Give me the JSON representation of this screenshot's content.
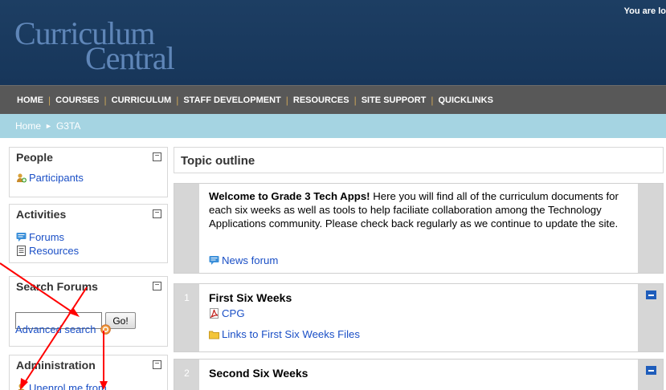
{
  "header": {
    "logo_line1": "Curriculum",
    "logo_line2": "Central",
    "login_info": "You are lo"
  },
  "nav": {
    "items": [
      "HOME",
      "COURSES",
      "CURRICULUM",
      "STAFF DEVELOPMENT",
      "RESOURCES",
      "SITE SUPPORT",
      "QUICKLINKS"
    ],
    "separator": "|"
  },
  "breadcrumb": {
    "home": "Home",
    "separator": "►",
    "current": "G3TA"
  },
  "sidebar": {
    "people": {
      "title": "People",
      "collapse": "−",
      "items": [
        {
          "label": "Participants",
          "icon": "people-icon"
        }
      ]
    },
    "activities": {
      "title": "Activities",
      "collapse": "−",
      "items": [
        {
          "label": "Forums",
          "icon": "forum-icon"
        },
        {
          "label": "Resources",
          "icon": "document-icon"
        }
      ]
    },
    "search_forums": {
      "title": "Search Forums",
      "collapse": "−",
      "input_value": "",
      "go_label": "Go!",
      "advanced_label": "Advanced search",
      "help_icon": "help-icon"
    },
    "administration": {
      "title": "Administration",
      "collapse": "−",
      "items": [
        {
          "label": "Unenrol me from",
          "icon": "user-icon"
        }
      ]
    }
  },
  "main": {
    "outline_title": "Topic outline",
    "welcome": {
      "bold": "Welcome to Grade 3 Tech Apps!",
      "text": " Here you will find all of the curriculum documents for each six weeks as well as tools to help faciliate collaboration among the Technology Applications community. Please check back regularly as we continue to update the site.",
      "news_label": "News forum"
    },
    "sections": [
      {
        "number": "1",
        "title": "First Six Weeks",
        "items": [
          {
            "label": "CPG",
            "icon": "pdf-icon"
          },
          {
            "label": "Links to First Six Weeks Files",
            "icon": "folder-icon"
          }
        ]
      },
      {
        "number": "2",
        "title": "Second Six Weeks",
        "items": []
      }
    ]
  },
  "colors": {
    "header_bg": "#1d3e63",
    "nav_bg": "#585858",
    "breadcrumb_bg": "#a5d4e2",
    "link": "#1a4fc6",
    "annotation": "#ff0000"
  }
}
